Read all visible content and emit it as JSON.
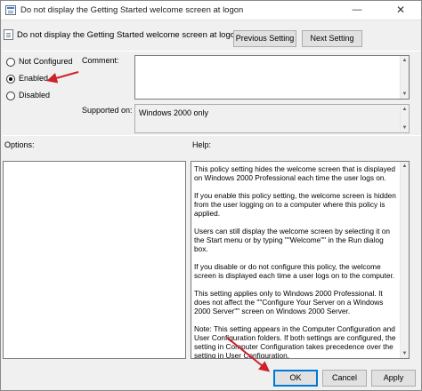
{
  "window": {
    "title": "Do not display the Getting Started welcome screen at logon",
    "minimize_glyph": "—",
    "close_glyph": "✕"
  },
  "setting": {
    "name": "Do not display the Getting Started welcome screen at logon"
  },
  "nav": {
    "previous_label": "Previous Setting",
    "next_label": "Next Setting"
  },
  "state": {
    "options": [
      "Not Configured",
      "Enabled",
      "Disabled"
    ],
    "selected": "Enabled"
  },
  "labels": {
    "comment": "Comment:",
    "supported_on": "Supported on:",
    "options": "Options:",
    "help": "Help:"
  },
  "comment_value": "",
  "supported_on_value": "Windows 2000 only",
  "help_paragraphs": [
    "This policy setting hides the welcome screen that is displayed on Windows 2000 Professional each time the user logs on.",
    "If you enable this policy setting, the welcome screen is hidden from the user logging on to a computer where this policy is applied.",
    "Users can still display the welcome screen by selecting it on the Start menu or by typing \"\"Welcome\"\" in the Run dialog box.",
    "If you disable or do not configure this policy, the welcome screen is displayed each time a user logs on to the computer.",
    "This setting applies only to Windows 2000 Professional. It does not affect the \"\"Configure Your Server on a Windows 2000 Server\"\" screen on Windows 2000 Server.",
    "Note: This setting appears in the Computer Configuration and User Configuration folders. If both settings are configured, the setting in Computer Configuration takes precedence over the setting in User Configuration."
  ],
  "buttons": {
    "ok": "OK",
    "cancel": "Cancel",
    "apply": "Apply"
  },
  "colors": {
    "annotation_arrow": "#d0202a",
    "focus_border": "#0078d7"
  },
  "icons": {
    "window": "policy-icon",
    "setting": "setting-document-icon",
    "annotation": "red-arrow"
  }
}
